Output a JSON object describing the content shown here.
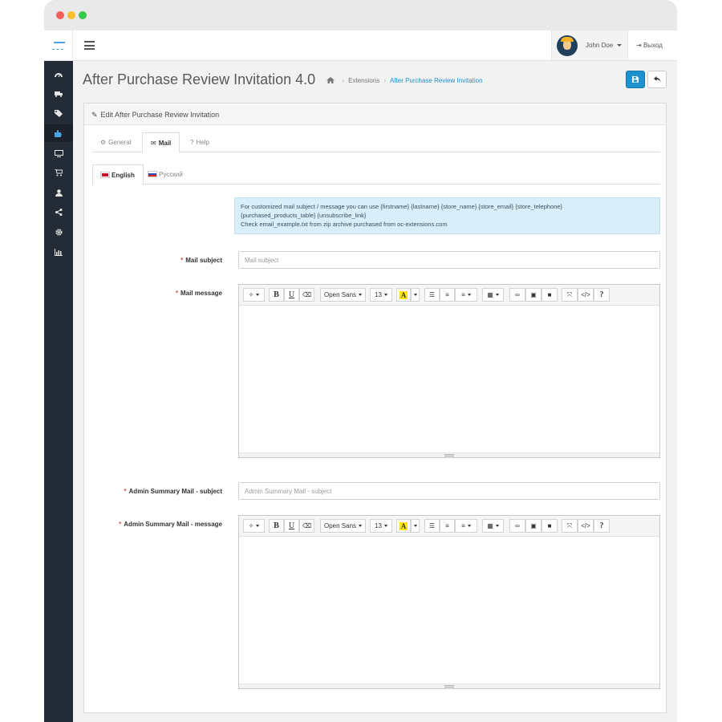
{
  "header": {
    "user_name": "John Doe",
    "logout_label": "Выход"
  },
  "sidebar": {
    "items": [
      {
        "icon": "dashboard-icon"
      },
      {
        "icon": "catalog-icon"
      },
      {
        "icon": "tags-icon"
      },
      {
        "icon": "extensions-icon",
        "active": true
      },
      {
        "icon": "design-icon"
      },
      {
        "icon": "cart-icon"
      },
      {
        "icon": "customers-icon"
      },
      {
        "icon": "share-icon"
      },
      {
        "icon": "settings-icon"
      },
      {
        "icon": "reports-icon"
      }
    ]
  },
  "page": {
    "title": "After Purchase Review Invitation 4.0",
    "breadcrumb": {
      "extensions": "Extensions",
      "current": "After Purchase Review Invitation"
    }
  },
  "panel": {
    "heading": "Edit After Purchase Review Invitation"
  },
  "tabs": {
    "general": "General",
    "mail": "Mail",
    "help": "Help",
    "active": "mail"
  },
  "languages": {
    "english": "English",
    "russian": "Русский",
    "active": "english"
  },
  "alert": {
    "line1": "For customized mail subject / message you can use {firstname} {lastname} {store_name} {store_email} {store_telephone}",
    "line2": "{purchased_products_table} {unsubscribe_link}",
    "line3": "Check email_example.txt from zip archive purchased from oc-extensions.com"
  },
  "fields": {
    "mail_subject": {
      "label": "Mail subject",
      "placeholder": "Mail subject",
      "value": ""
    },
    "mail_message": {
      "label": "Mail message"
    },
    "admin_subject": {
      "label": "Admin Summary Mail - subject",
      "placeholder": "Admin Summary Mail - subject",
      "value": ""
    },
    "admin_message": {
      "label": "Admin Summary Mail - message"
    }
  },
  "toolbar": {
    "font_family": "Open Sans",
    "font_size": "13",
    "highlight_letter": "A",
    "bold": "B",
    "underline": "U",
    "help": "?",
    "code": "</>"
  },
  "colors": {
    "primary": "#1e91cf",
    "sidebar": "#232b36",
    "alert_bg": "#d8eef8",
    "required": "#d9534f"
  }
}
